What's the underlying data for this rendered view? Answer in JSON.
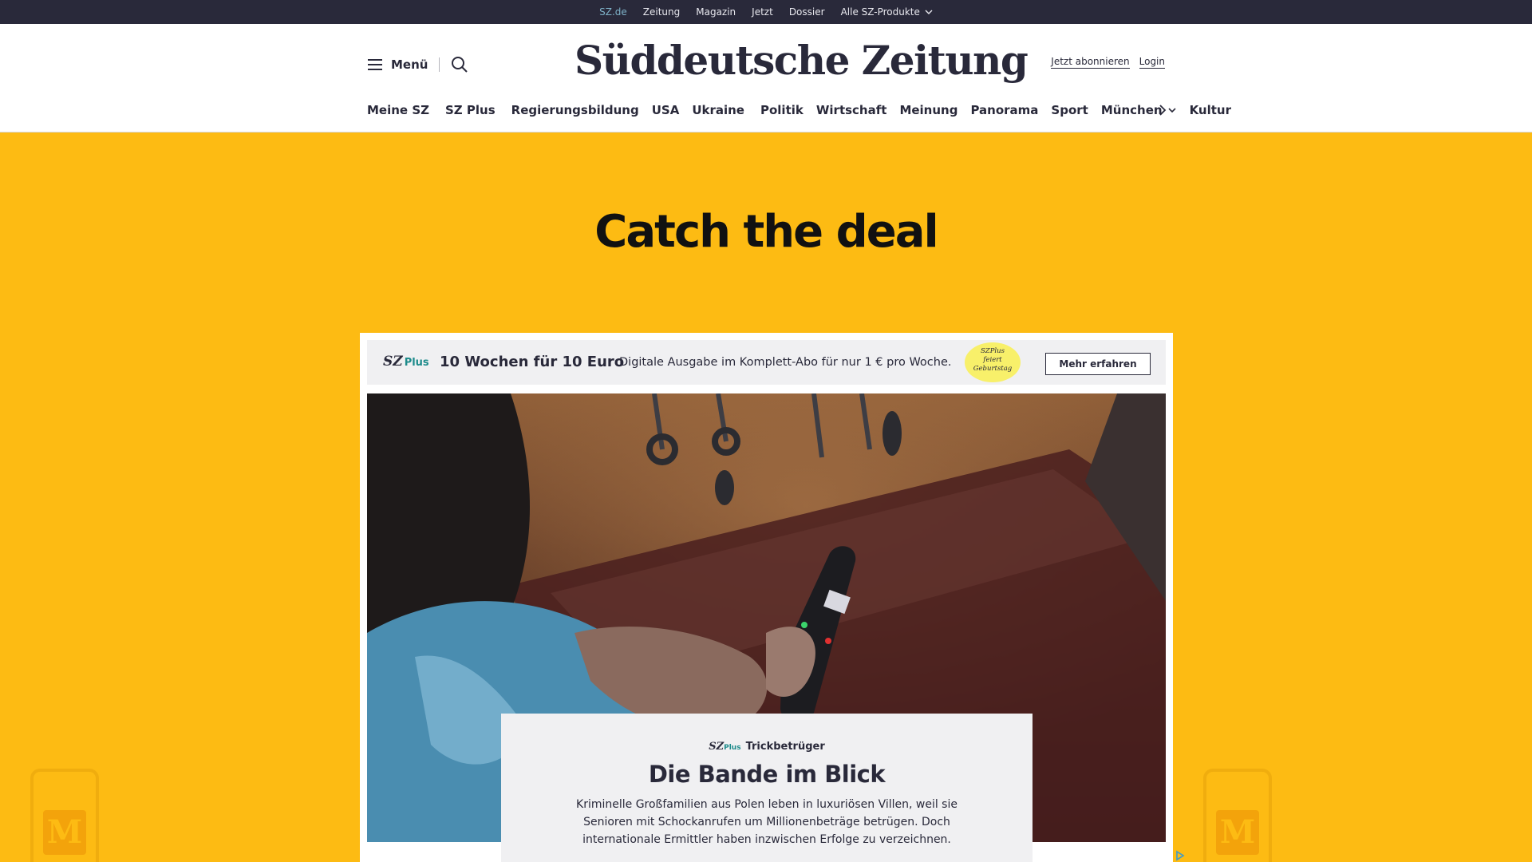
{
  "topbar": {
    "links": [
      "SZ.de",
      "Zeitung",
      "Magazin",
      "Jetzt",
      "Dossier"
    ],
    "products_label": "Alle SZ-Produkte"
  },
  "header": {
    "menu_label": "Menü",
    "logo_text": "Süddeutsche Zeitung",
    "subscribe_label": "Jetzt abonnieren",
    "login_label": "Login"
  },
  "nav": {
    "items": [
      "Meine SZ",
      "SZ Plus",
      "Regierungsbildung",
      "USA",
      "Ukraine",
      "Politik",
      "Wirtschaft",
      "Meinung",
      "Panorama",
      "Sport",
      "München",
      "Kultur"
    ]
  },
  "ad": {
    "headline": "Catch the deal"
  },
  "promo": {
    "brand_sz": "SZ",
    "brand_plus": "Plus",
    "title": "10 Wochen für 10 Euro",
    "description": "Digitale Ausgabe im Komplett-Abo für nur 1 € pro Woche.",
    "badge_line1": "SZPlus",
    "badge_line2": "feiert",
    "badge_line3": "Geburtstag",
    "cta_label": "Mehr erfahren"
  },
  "teaser": {
    "brand_sz": "SZ",
    "brand_plus": "Plus",
    "kicker": "Trickbetrüger",
    "title": "Die Bande im Blick",
    "text": "Kriminelle Großfamilien aus Polen leben in luxuriösen Villen, weil sie Senioren mit Schockanrufen um Millionenbeträge betrügen. Doch internationale Ermittler haben inzwischen Erfolge zu verzeichnen."
  },
  "phone_logo": "M",
  "colors": {
    "background": "#fdbb13",
    "header_dark": "#29293a",
    "accent_teal": "#1d8b8b"
  }
}
